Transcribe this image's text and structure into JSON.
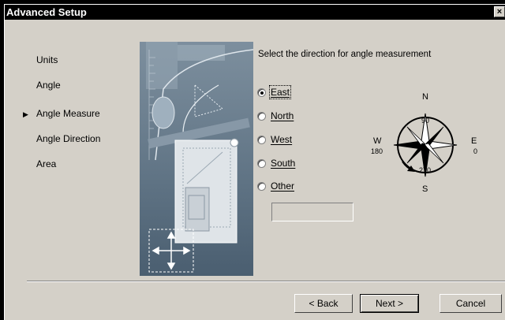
{
  "window": {
    "title": "Advanced Setup",
    "close_glyph": "×"
  },
  "steps": [
    {
      "label": "Units",
      "current": false
    },
    {
      "label": "Angle",
      "current": false
    },
    {
      "label": "Angle Measure",
      "current": true
    },
    {
      "label": "Angle Direction",
      "current": false
    },
    {
      "label": "Area",
      "current": false
    }
  ],
  "current_step_marker": "▶",
  "prompt": "Select the direction for angle measurement",
  "options": [
    {
      "label": "East",
      "checked": true
    },
    {
      "label": "North",
      "checked": false
    },
    {
      "label": "West",
      "checked": false
    },
    {
      "label": "South",
      "checked": false
    },
    {
      "label": "Other",
      "checked": false
    }
  ],
  "other_value": "",
  "compass": {
    "north": "N",
    "south": "S",
    "east": "E",
    "west": "W",
    "deg_north": "90",
    "deg_south": "270",
    "deg_east": "0",
    "deg_west": "180"
  },
  "buttons": {
    "back": "< Back",
    "next": "Next >",
    "cancel": "Cancel"
  }
}
